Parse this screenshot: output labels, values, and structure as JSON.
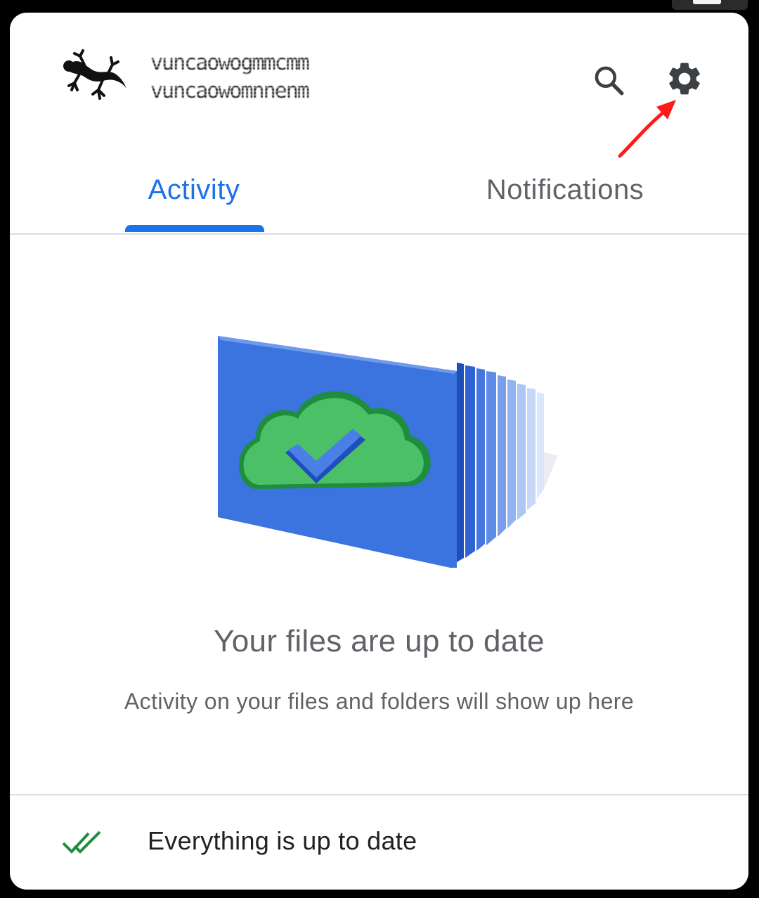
{
  "account": {
    "name_line": "vuncaowogmmcmm",
    "email_line": "vuncaowomnnenm"
  },
  "header": {
    "avatar_icon": "gecko-avatar-icon",
    "search_icon": "search-icon",
    "settings_icon": "gear-icon",
    "annotation_icon": "red-arrow-icon"
  },
  "tabs": [
    {
      "label": "Activity",
      "selected": true
    },
    {
      "label": "Notifications",
      "selected": false
    }
  ],
  "empty_state": {
    "illustration_icon": "cloud-check-folder-illustration",
    "title": "Your files are up to date",
    "subtitle": "Activity on your files and folders will show up here"
  },
  "footer": {
    "status_icon": "double-check-icon",
    "status_text": "Everything is up to date"
  },
  "colors": {
    "accent": "#1a73e8",
    "text_primary": "#202124",
    "text_secondary": "#5f6368",
    "success": "#1e8e3e",
    "annotation": "#ff0000"
  }
}
